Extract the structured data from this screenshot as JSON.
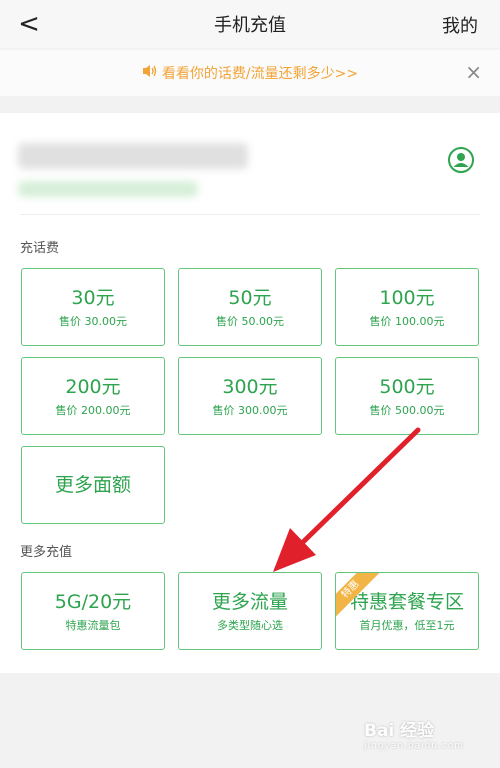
{
  "nav": {
    "title": "手机充值",
    "mine": "我的",
    "back": "<"
  },
  "notice": {
    "text": "看看你的话费/流量还剩多少>>",
    "close": "×"
  },
  "recharge_title": "充话费",
  "recharge_cards": [
    {
      "amount": "30元",
      "price": "售价 30.00元"
    },
    {
      "amount": "50元",
      "price": "售价 50.00元"
    },
    {
      "amount": "100元",
      "price": "售价 100.00元"
    },
    {
      "amount": "200元",
      "price": "售价 200.00元"
    },
    {
      "amount": "300元",
      "price": "售价 300.00元"
    },
    {
      "amount": "500元",
      "price": "售价 500.00元"
    }
  ],
  "more_amount": "更多面额",
  "more_title": "更多充值",
  "more_cards": [
    {
      "title": "5G/20元",
      "sub": "特惠流量包"
    },
    {
      "title": "更多流量",
      "sub": "多类型随心选"
    },
    {
      "title": "特惠套餐专区",
      "sub": "首月优惠，低至1元",
      "ribbon": "特惠"
    }
  ],
  "watermark": {
    "logo": "Bai 经验",
    "sub": "jingyan.baidu.com"
  },
  "colors": {
    "green": "#2ea44f",
    "border": "#62c77d",
    "orange": "#f2a438",
    "arrow": "#e0212b"
  }
}
